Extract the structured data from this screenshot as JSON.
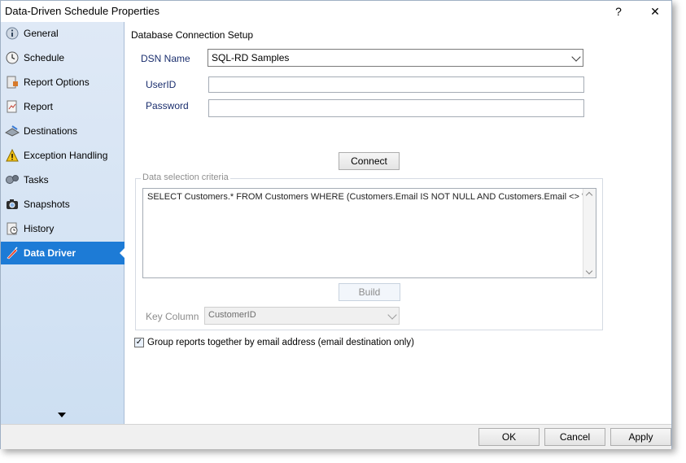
{
  "window": {
    "title": "Data-Driven Schedule Properties",
    "help_label": "?",
    "close_label": "✕"
  },
  "sidebar": {
    "items": [
      {
        "label": "General",
        "icon": "info-icon"
      },
      {
        "label": "Schedule",
        "icon": "clock-icon"
      },
      {
        "label": "Report Options",
        "icon": "report-options-icon"
      },
      {
        "label": "Report",
        "icon": "report-icon"
      },
      {
        "label": "Destinations",
        "icon": "destinations-icon"
      },
      {
        "label": "Exception Handling",
        "icon": "warning-icon"
      },
      {
        "label": "Tasks",
        "icon": "tasks-icon"
      },
      {
        "label": "Snapshots",
        "icon": "camera-icon"
      },
      {
        "label": "History",
        "icon": "history-icon"
      },
      {
        "label": "Data Driver",
        "icon": "data-driver-icon"
      }
    ],
    "active_index": 9
  },
  "main": {
    "section_title": "Database Connection Setup",
    "dsn_label": "DSN Name",
    "dsn_value": "SQL-RD Samples",
    "userid_label": "UserID",
    "userid_value": "",
    "password_label": "Password",
    "password_value": "",
    "connect_label": "Connect",
    "criteria_group_title": "Data selection criteria",
    "criteria_sql": "SELECT Customers.* FROM Customers WHERE (Customers.Email IS NOT NULL AND Customers.Email <> '')",
    "build_label": "Build",
    "key_column_label": "Key Column",
    "key_column_value": "CustomerID",
    "group_reports_label": "Group reports together by email address (email destination only)",
    "group_reports_checked": true
  },
  "footer": {
    "ok_label": "OK",
    "cancel_label": "Cancel",
    "apply_label": "Apply"
  },
  "colors": {
    "active_nav": "#1d7bd6",
    "sidebar_bg": "#dfe9f6",
    "label_blue": "#1a2e6e"
  }
}
